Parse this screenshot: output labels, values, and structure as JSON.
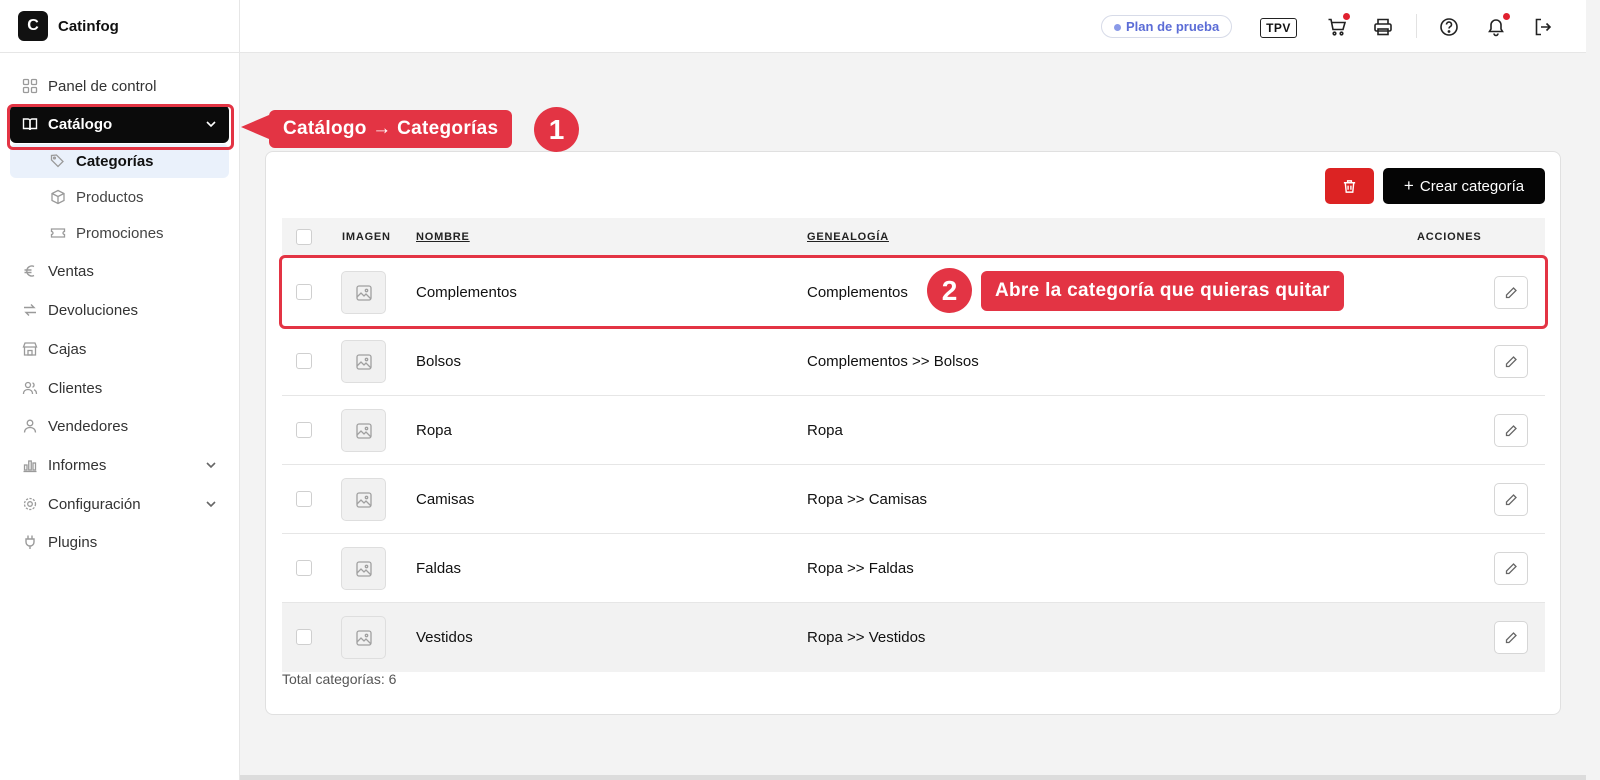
{
  "brand": {
    "logo_letter": "C",
    "name": "Catinfog"
  },
  "sidebar": {
    "items": [
      {
        "label": "Panel de control",
        "icon": "grid-icon"
      },
      {
        "label": "Catálogo",
        "icon": "book-open-icon",
        "active": true,
        "expandable": true
      },
      {
        "label": "Ventas",
        "icon": "euro-icon"
      },
      {
        "label": "Devoluciones",
        "icon": "return-arrows-icon"
      },
      {
        "label": "Cajas",
        "icon": "store-icon"
      },
      {
        "label": "Clientes",
        "icon": "users-icon"
      },
      {
        "label": "Vendedores",
        "icon": "user-icon"
      },
      {
        "label": "Informes",
        "icon": "chart-icon",
        "expandable": true
      },
      {
        "label": "Configuración",
        "icon": "gear-icon",
        "expandable": true
      },
      {
        "label": "Plugins",
        "icon": "plug-icon"
      }
    ],
    "catalog_sub": [
      {
        "label": "Categorías",
        "icon": "tags-icon",
        "selected": true
      },
      {
        "label": "Productos",
        "icon": "box-icon"
      },
      {
        "label": "Promociones",
        "icon": "ticket-icon"
      }
    ]
  },
  "header": {
    "plan_badge": "Plan de prueba",
    "tpv_label": "TPV",
    "icons": [
      "cart-icon",
      "printer-icon",
      "help-icon",
      "bell-icon",
      "logout-icon"
    ]
  },
  "toolbar": {
    "create_label": "Crear categoría"
  },
  "table": {
    "headers": {
      "image": "IMAGEN",
      "name": "NOMBRE",
      "genealogy": "GENEALOGÍA",
      "actions": "ACCIONES"
    },
    "rows": [
      {
        "name": "Complementos",
        "genealogy": "Complementos"
      },
      {
        "name": "Bolsos",
        "genealogy": "Complementos >> Bolsos"
      },
      {
        "name": "Ropa",
        "genealogy": "Ropa"
      },
      {
        "name": "Camisas",
        "genealogy": "Ropa >> Camisas"
      },
      {
        "name": "Faldas",
        "genealogy": "Ropa >> Faldas"
      },
      {
        "name": "Vestidos",
        "genealogy": "Ropa >> Vestidos"
      }
    ],
    "total": "Total categorías: 6"
  },
  "annotations": {
    "step1_label": "Catálogo → Categorías",
    "step1_num": "1",
    "step2_label": "Abre la categoría que quieras quitar",
    "step2_num": "2"
  },
  "colors": {
    "accent_red": "#e33444",
    "delete_red": "#dc2323",
    "primary_black": "#050505",
    "plan_blue": "#5b6cd6"
  }
}
